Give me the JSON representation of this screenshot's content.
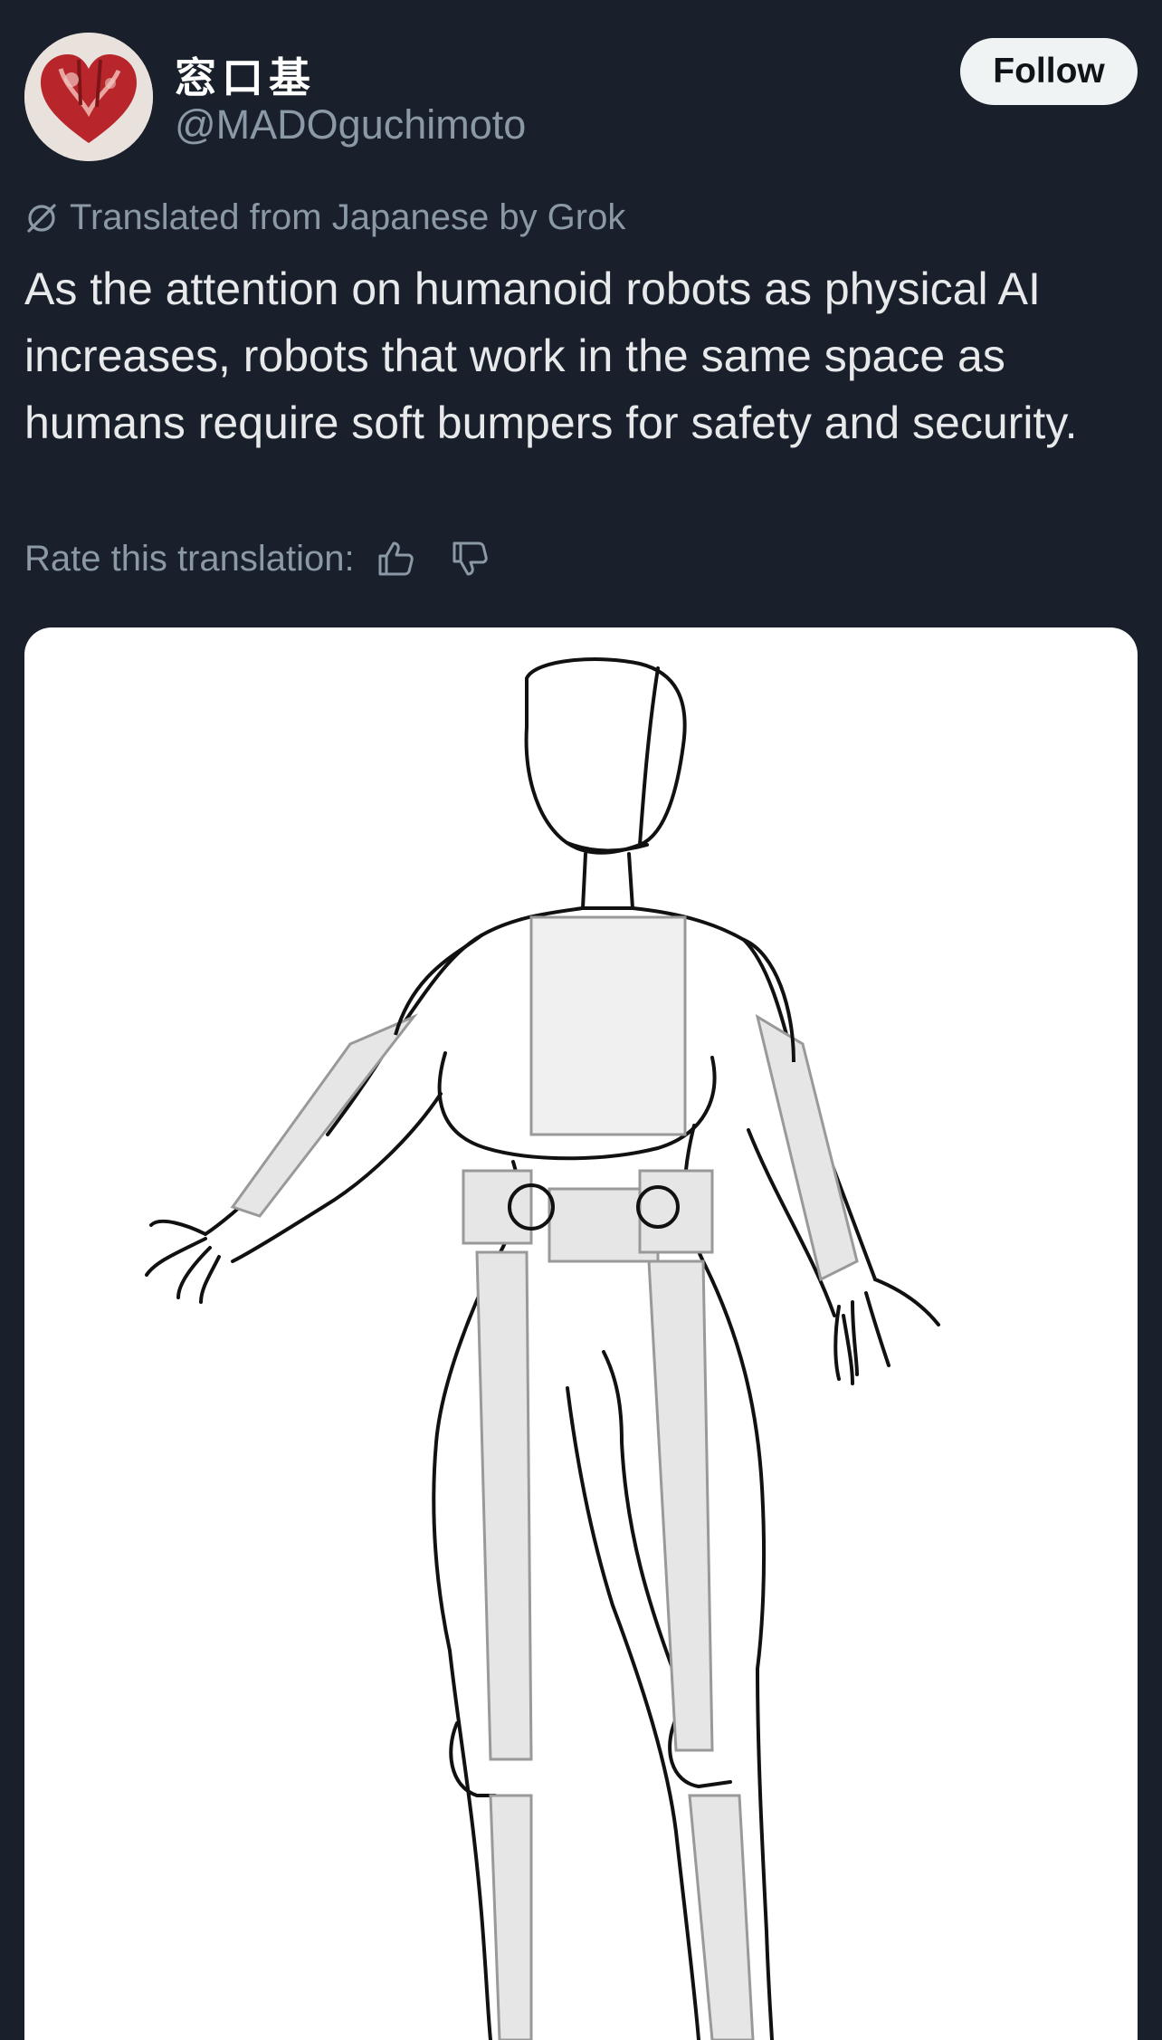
{
  "author": {
    "display_name": "窓口基",
    "handle": "@MADOguchimoto",
    "avatar_icon": "heart-avatar-icon"
  },
  "follow_label": "Follow",
  "translation": {
    "label": "Translated from Japanese by Grok",
    "icon": "grok-icon"
  },
  "tweet": {
    "text": "As the attention on humanoid robots as physical AI increases, robots that work in the same space as humans require soft bumpers for safety and security."
  },
  "rating": {
    "label": "Rate this translation:",
    "up_icon": "thumbs-up-icon",
    "down_icon": "thumbs-down-icon"
  },
  "media": {
    "type": "sketch-image"
  },
  "colors": {
    "background": "#19202b",
    "text": "#e7e9ea",
    "muted": "#8b98a5",
    "follow_bg": "#eff3f4"
  }
}
